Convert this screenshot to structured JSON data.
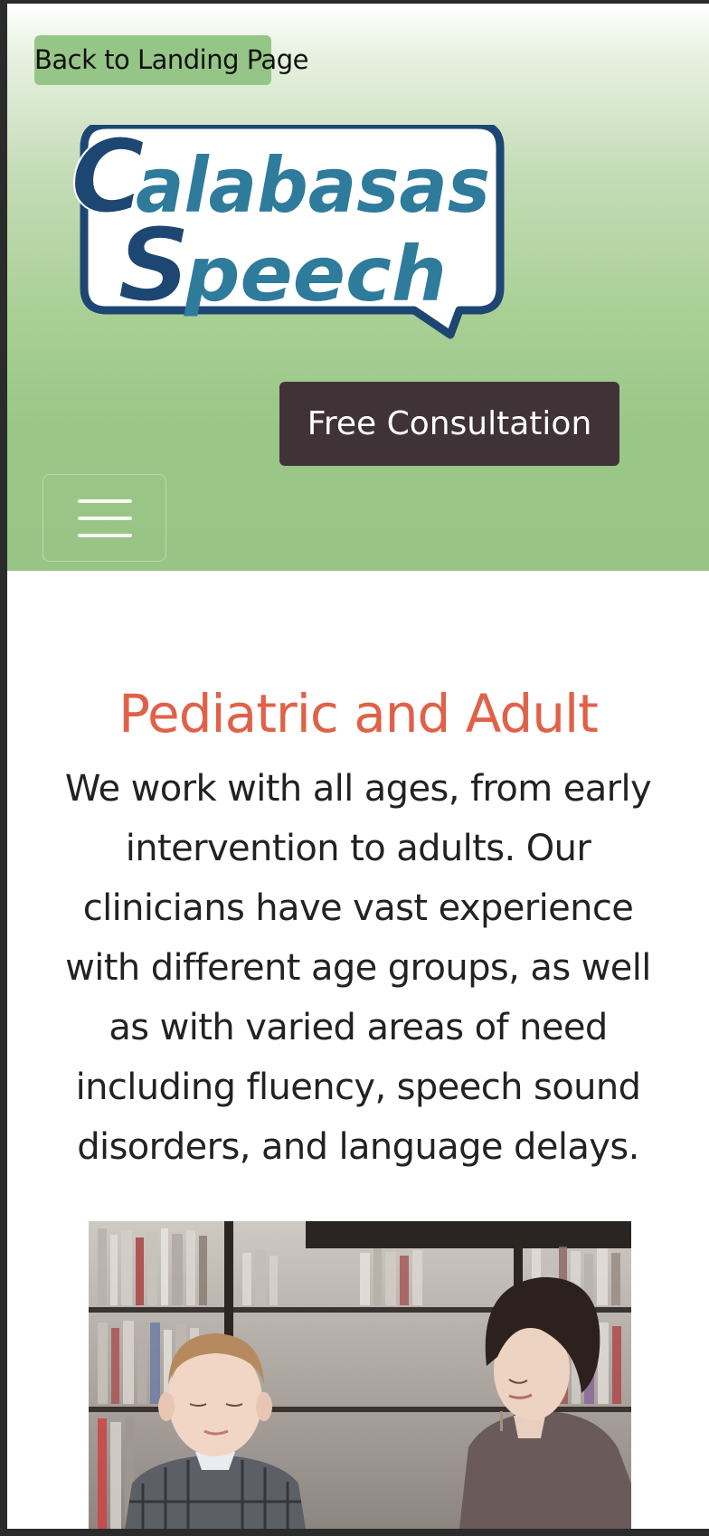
{
  "header": {
    "back_button_label": "Back to Landing Page",
    "logo": {
      "line1": "Calabasas",
      "line2": "Speech",
      "colors": {
        "dark": "#1d4673",
        "accent": "#2e7b9c"
      }
    },
    "consultation_button_label": "Free Consultation",
    "menu_icon": "hamburger-menu-icon",
    "colors": {
      "gradient_bottom": "#98c586",
      "back_button_bg": "#96c687",
      "consultation_button_bg": "#403338"
    }
  },
  "main": {
    "section_title": "Pediatric and Adult",
    "section_text": "We work with all ages, from early intervention to adults. Our clinicians have vast experience with different age groups, as well as with varied areas of need including fluency, speech sound disorders, and language delays.",
    "image_subject": "boy and woman reading together in a library",
    "colors": {
      "title": "#e06148",
      "body_text": "#222222"
    }
  }
}
